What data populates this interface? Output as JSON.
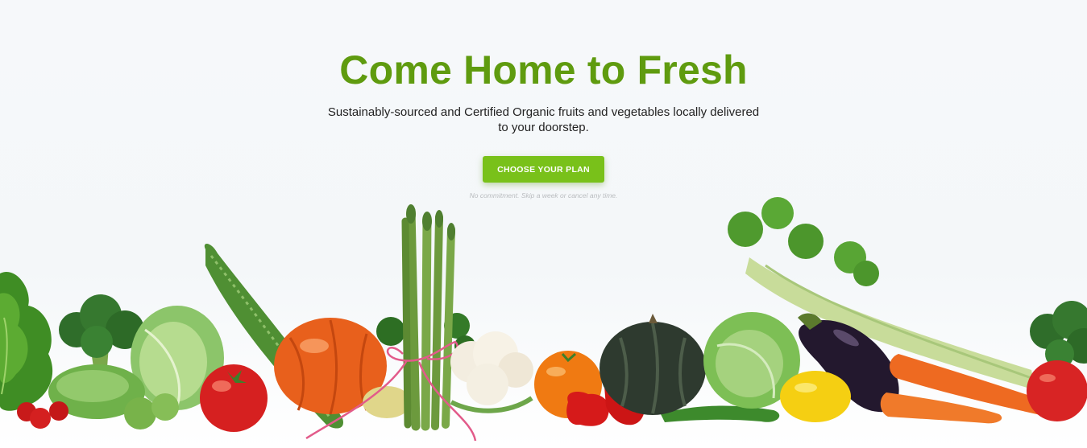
{
  "hero": {
    "title": "Come Home to Fresh",
    "subtitle": "Sustainably-sourced and Certified Organic fruits and vegetables locally delivered to your doorstep.",
    "cta_label": "CHOOSE YOUR PLAN",
    "fineprint": "No commitment. Skip a week or cancel any time."
  },
  "colors": {
    "title": "#5f9b0f",
    "cta_background": "#79c11a",
    "cta_text": "#ffffff",
    "subtitle_text": "#222222",
    "fineprint_text": "#b9bcbf"
  },
  "image": {
    "name": "vegetable-row-photo",
    "depicts": [
      "lettuce",
      "broccoli",
      "cabbage",
      "cucumber",
      "bitter-melon",
      "tomato",
      "kabocha",
      "asparagus",
      "ribbon",
      "cauliflower",
      "parsley",
      "squash",
      "bell-pepper",
      "celery",
      "eggplant",
      "lemon",
      "carrot",
      "green-pepper"
    ]
  }
}
